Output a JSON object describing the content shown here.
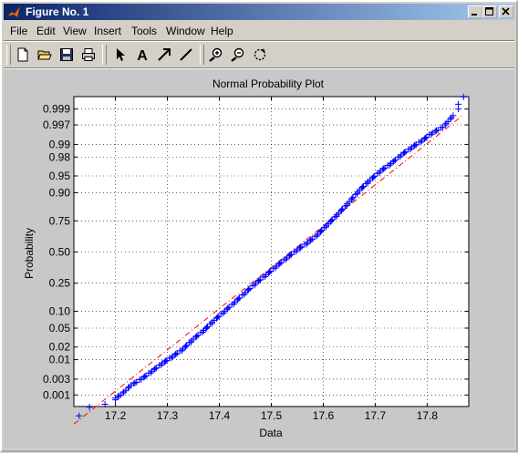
{
  "window": {
    "title": "Figure No. 1",
    "minimize_label": "minimize",
    "maximize_label": "maximize",
    "close_label": "close"
  },
  "menu": [
    "File",
    "Edit",
    "View",
    "Insert",
    "Tools",
    "Window",
    "Help"
  ],
  "toolbar": {
    "tools": [
      "new-file-icon",
      "open-folder-icon",
      "save-icon",
      "print-icon",
      "select-arrow-icon",
      "text-insert-icon",
      "arrow-insert-icon",
      "line-insert-icon",
      "zoom-in-icon",
      "zoom-out-icon",
      "rotate-icon"
    ],
    "text_tool_label": "A"
  },
  "chart_data": {
    "type": "scatter",
    "title": "Normal Probability Plot",
    "xlabel": "Data",
    "ylabel": "Probability",
    "x_ticks": [
      17.2,
      17.3,
      17.4,
      17.5,
      17.6,
      17.7,
      17.8
    ],
    "x_tick_labels": [
      "17.2",
      "17.3",
      "17.4",
      "17.5",
      "17.6",
      "17.7",
      "17.8"
    ],
    "xlim": [
      17.12,
      17.88
    ],
    "y_scale": "normal-probability",
    "y_ticks": [
      0.001,
      0.003,
      0.01,
      0.02,
      0.05,
      0.1,
      0.25,
      0.5,
      0.75,
      0.9,
      0.95,
      0.98,
      0.99,
      0.997,
      0.999
    ],
    "y_tick_labels": [
      "0.001",
      "0.003",
      "0.01",
      "0.02",
      "0.05",
      "0.10",
      "0.25",
      "0.50",
      "0.75",
      "0.90",
      "0.95",
      "0.98",
      "0.99",
      "0.997",
      "0.999"
    ],
    "grid": true,
    "marker": "+",
    "marker_color": "#0000ff",
    "reference_line": {
      "style": "dash-dot",
      "color": "#ff0000",
      "points": [
        [
          17.12,
          0.0001
        ],
        [
          17.87,
          0.9985
        ]
      ]
    },
    "series_points": [
      [
        17.13,
        0.0002
      ],
      [
        17.15,
        0.0004
      ],
      [
        17.18,
        0.0005
      ],
      [
        17.2,
        0.0007
      ],
      [
        17.2,
        0.0008
      ],
      [
        17.21,
        0.001
      ],
      [
        17.22,
        0.0014
      ],
      [
        17.23,
        0.002
      ],
      [
        17.25,
        0.003
      ],
      [
        17.27,
        0.005
      ],
      [
        17.29,
        0.008
      ],
      [
        17.31,
        0.012
      ],
      [
        17.33,
        0.018
      ],
      [
        17.35,
        0.03
      ],
      [
        17.37,
        0.045
      ],
      [
        17.39,
        0.07
      ],
      [
        17.41,
        0.1
      ],
      [
        17.43,
        0.14
      ],
      [
        17.45,
        0.19
      ],
      [
        17.47,
        0.25
      ],
      [
        17.49,
        0.31
      ],
      [
        17.51,
        0.38
      ],
      [
        17.53,
        0.45
      ],
      [
        17.55,
        0.52
      ],
      [
        17.57,
        0.58
      ],
      [
        17.59,
        0.65
      ],
      [
        17.61,
        0.73
      ],
      [
        17.63,
        0.8
      ],
      [
        17.65,
        0.86
      ],
      [
        17.67,
        0.91
      ],
      [
        17.69,
        0.94
      ],
      [
        17.71,
        0.96
      ],
      [
        17.73,
        0.972
      ],
      [
        17.75,
        0.982
      ],
      [
        17.77,
        0.988
      ],
      [
        17.79,
        0.992
      ],
      [
        17.81,
        0.995
      ],
      [
        17.83,
        0.9965
      ],
      [
        17.84,
        0.9976
      ],
      [
        17.85,
        0.9984
      ],
      [
        17.86,
        0.999
      ],
      [
        17.86,
        0.9993
      ],
      [
        17.87,
        0.9996
      ]
    ]
  }
}
